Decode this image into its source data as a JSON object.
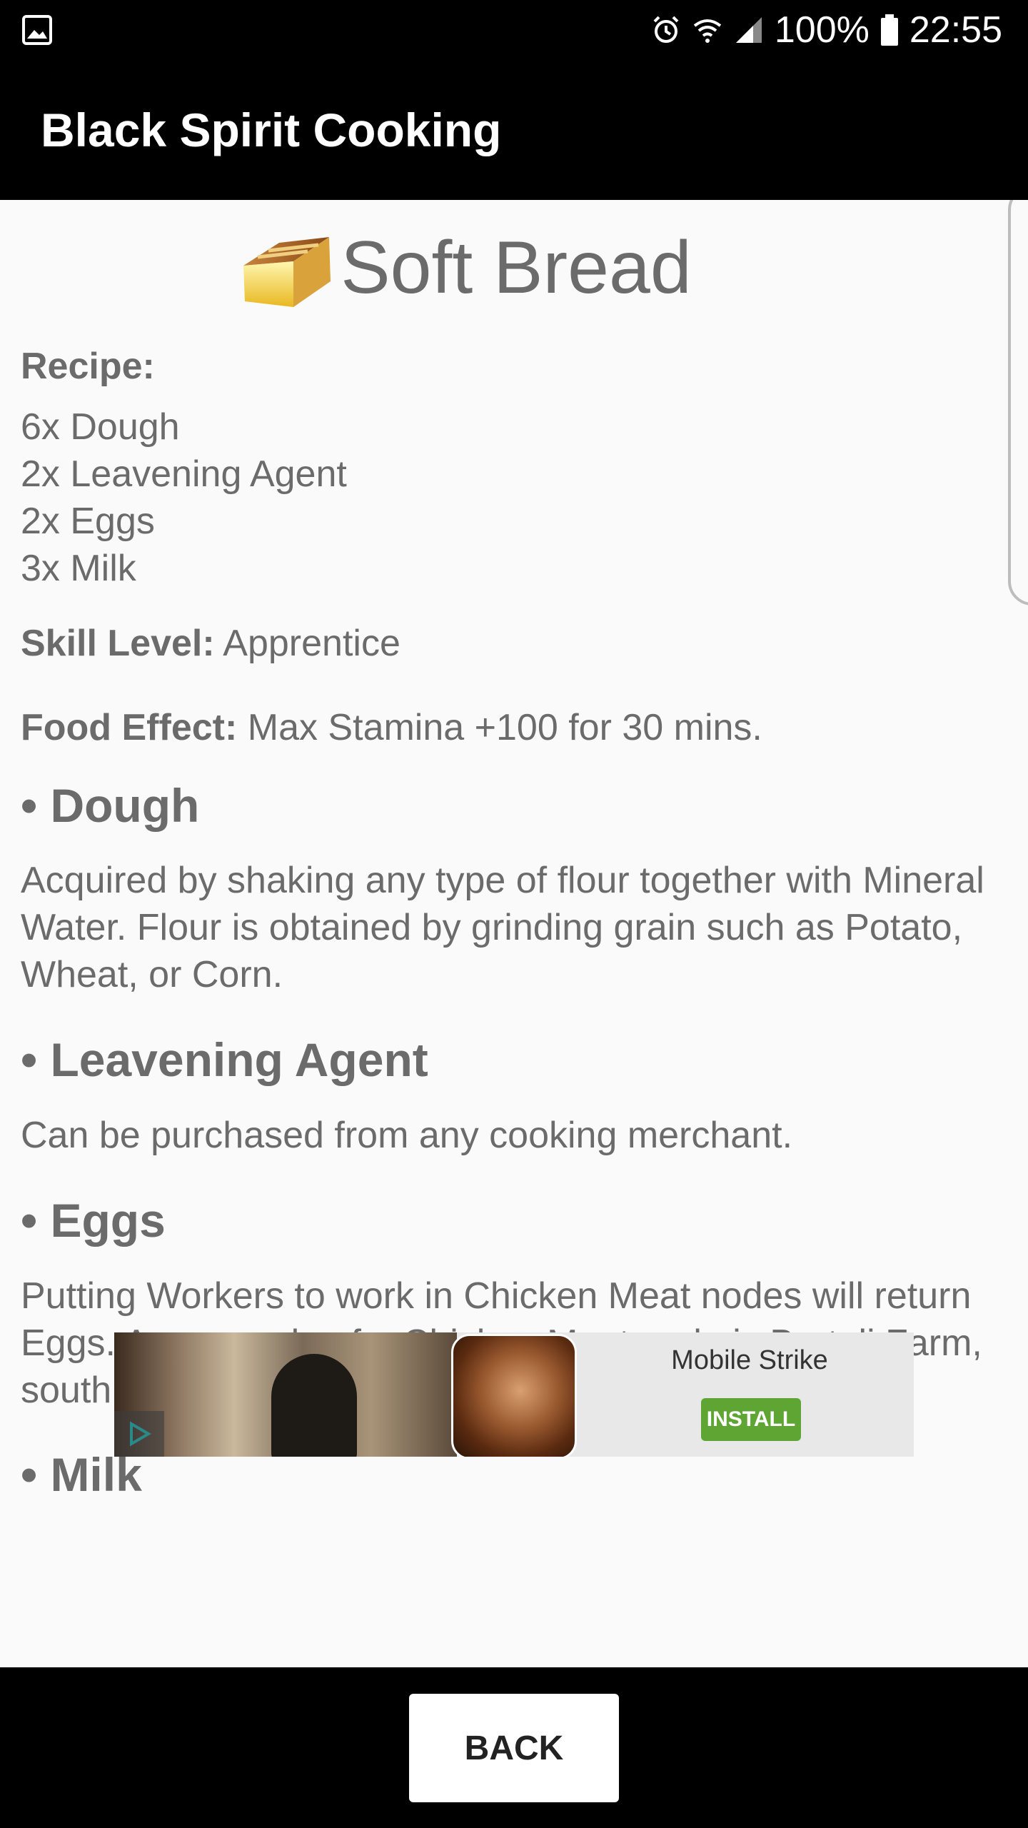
{
  "status_bar": {
    "battery": "100%",
    "time": "22:55",
    "icons": [
      "gallery-icon",
      "alarm-icon",
      "wifi-icon",
      "signal-icon",
      "battery-icon"
    ]
  },
  "app_bar": {
    "title": "Black Spirit Cooking"
  },
  "item": {
    "name": "Soft Bread",
    "icon": "bread-icon"
  },
  "recipe": {
    "label": "Recipe:",
    "ingredients": [
      "6x Dough",
      "2x Leavening Agent",
      "2x Eggs",
      "3x Milk"
    ]
  },
  "skill": {
    "label": "Skill Level:",
    "value": "Apprentice"
  },
  "food_effect": {
    "label": "Food Effect:",
    "value": "Max Stamina +100 for 30 mins."
  },
  "sections": [
    {
      "heading": "• Dough",
      "text": "Acquired by shaking any type of flour together with Mineral Water. Flour is obtained by grinding grain such as Potato, Wheat, or Corn."
    },
    {
      "heading": "• Leavening Agent",
      "text": "Can be purchased from any cooking merchant."
    },
    {
      "heading": "• Eggs",
      "text": "Putting Workers to work in Chicken Meat nodes will return Eggs. An example of a Chicken Meat node is Bartali Farm, south of Velia."
    },
    {
      "heading": "• Milk",
      "text": ""
    }
  ],
  "ad": {
    "name": "Mobile Strike",
    "install_label": "INSTALL"
  },
  "back_button": {
    "label": "BACK"
  },
  "colors": {
    "bar": "#000000",
    "text": "#6b6b6b",
    "install": "#5fa534",
    "background": "#fafafa"
  }
}
